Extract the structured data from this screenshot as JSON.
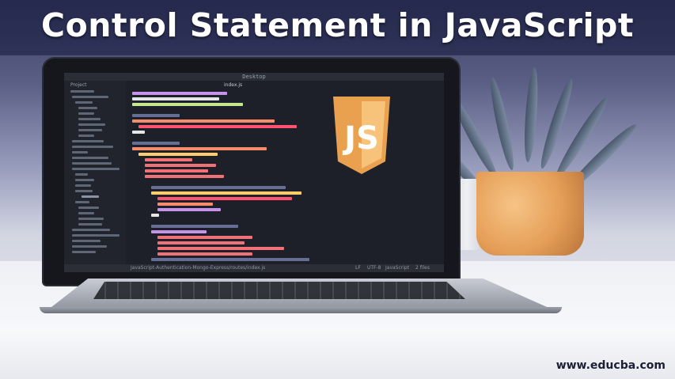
{
  "banner": {
    "title": "Control Statement in JavaScript"
  },
  "editor": {
    "window_title": "Desktop",
    "sidebar_header": "Project",
    "tabs": [
      {
        "label": "index.js"
      }
    ],
    "statusbar": {
      "path": "JavaScript-Authentication-Mongo-Express/routes/index.js",
      "line_ending": "LF",
      "encoding": "UTF-8",
      "language": "JavaScript",
      "files": "2 files"
    }
  },
  "badge": {
    "text": "JS",
    "icon": "javascript-shield-icon",
    "colors": {
      "outer": "#e9a14f",
      "inner": "#f7c27a",
      "text": "#ffffff"
    }
  },
  "watermark": {
    "text": "www.educba.com"
  }
}
